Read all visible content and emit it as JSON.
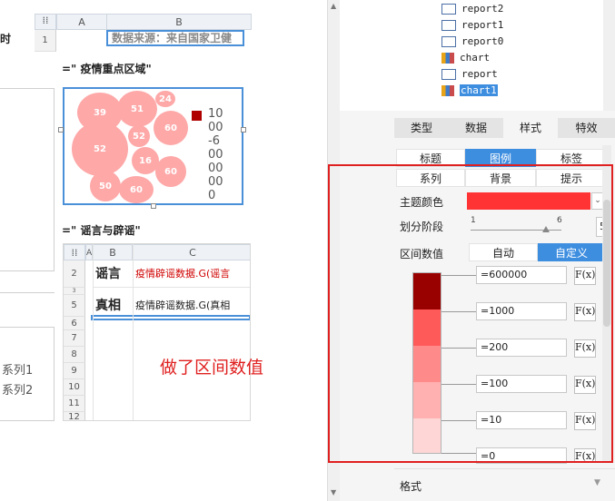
{
  "sheet_top": {
    "col_a": "A",
    "col_b": "B",
    "row1": "1",
    "source_text": "数据来源：来自国家卫健",
    "left_clip": "时"
  },
  "chart_block": {
    "title": "=\" 疫情重点区域\"",
    "bubbles": [
      "39",
      "24",
      "51",
      "52",
      "60",
      "52",
      "16",
      "60",
      "50",
      "60"
    ],
    "legend_numbers": [
      "10",
      "00",
      "-6",
      "00",
      "00",
      "00",
      "0"
    ],
    "legend_color": "#b00000"
  },
  "rumor_block": {
    "title": "=\" 谣言与辟谣\"",
    "col_a": "A",
    "col_b": "B",
    "col_c": "C",
    "rows": [
      {
        "no": "2",
        "b": "谣言",
        "c": "疫情辟谣数据.G(谣言"
      },
      {
        "no": "5",
        "b": "真相",
        "c": "疫情辟谣数据.G(真相"
      }
    ],
    "extra_rows": [
      "6",
      "7",
      "8",
      "9",
      "10",
      "11",
      "12"
    ],
    "tiny_marker": "3"
  },
  "series_labels": [
    "系列1",
    "系列2"
  ],
  "annotation": "做了区间数值",
  "tree": {
    "items": [
      "report2",
      "report1",
      "report0",
      "chart",
      "report",
      "chart1"
    ],
    "selected": "chart1"
  },
  "main_tabs": [
    "类型",
    "数据",
    "样式",
    "特效"
  ],
  "main_tab_active": "样式",
  "sub_tabs_row1": [
    "标题",
    "图例",
    "标签"
  ],
  "sub_tab_active": "图例",
  "sub_tabs_row2": [
    "系列",
    "背景",
    "提示"
  ],
  "theme_color": {
    "label": "主题颜色",
    "value": "#ff3333"
  },
  "stages": {
    "label": "划分阶段",
    "min": "1",
    "max": "6",
    "value": "5",
    "level": 0.83
  },
  "interval": {
    "label": "区间数值",
    "options": [
      "自动",
      "自定义"
    ],
    "active": "自定义"
  },
  "ranges": [
    {
      "value": "=600000",
      "color": "#990000"
    },
    {
      "value": "=1000",
      "color": "#ff5a5a"
    },
    {
      "value": "=200",
      "color": "#ff8a8a"
    },
    {
      "value": "=100",
      "color": "#ffb0b0"
    },
    {
      "value": "=10",
      "color": "#ffd6d6"
    },
    {
      "value": "=0"
    }
  ],
  "fx_label": "F(x)",
  "format_label": "格式",
  "highlight_color": "#e02020"
}
